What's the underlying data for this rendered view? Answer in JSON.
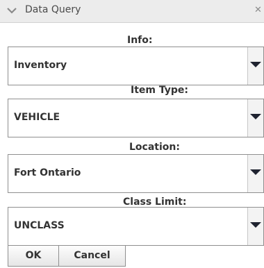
{
  "window": {
    "title": "Data Query",
    "collapse_icon": "chevron-down-icon",
    "close_icon": "close-icon"
  },
  "form": {
    "info": {
      "label": "Info:",
      "value": "Inventory"
    },
    "item_type": {
      "label": "Item Type:",
      "value": "VEHICLE"
    },
    "location": {
      "label": "Location:",
      "value": "Fort Ontario"
    },
    "class_limit": {
      "label": "Class Limit:",
      "value": "UNCLASS"
    }
  },
  "buttons": {
    "ok_label": "OK",
    "cancel_label": "Cancel"
  },
  "colors": {
    "titlebar_bg": "#ececec",
    "text": "#333333",
    "border": "#8f8f8f",
    "arrow": "#1f2330"
  }
}
